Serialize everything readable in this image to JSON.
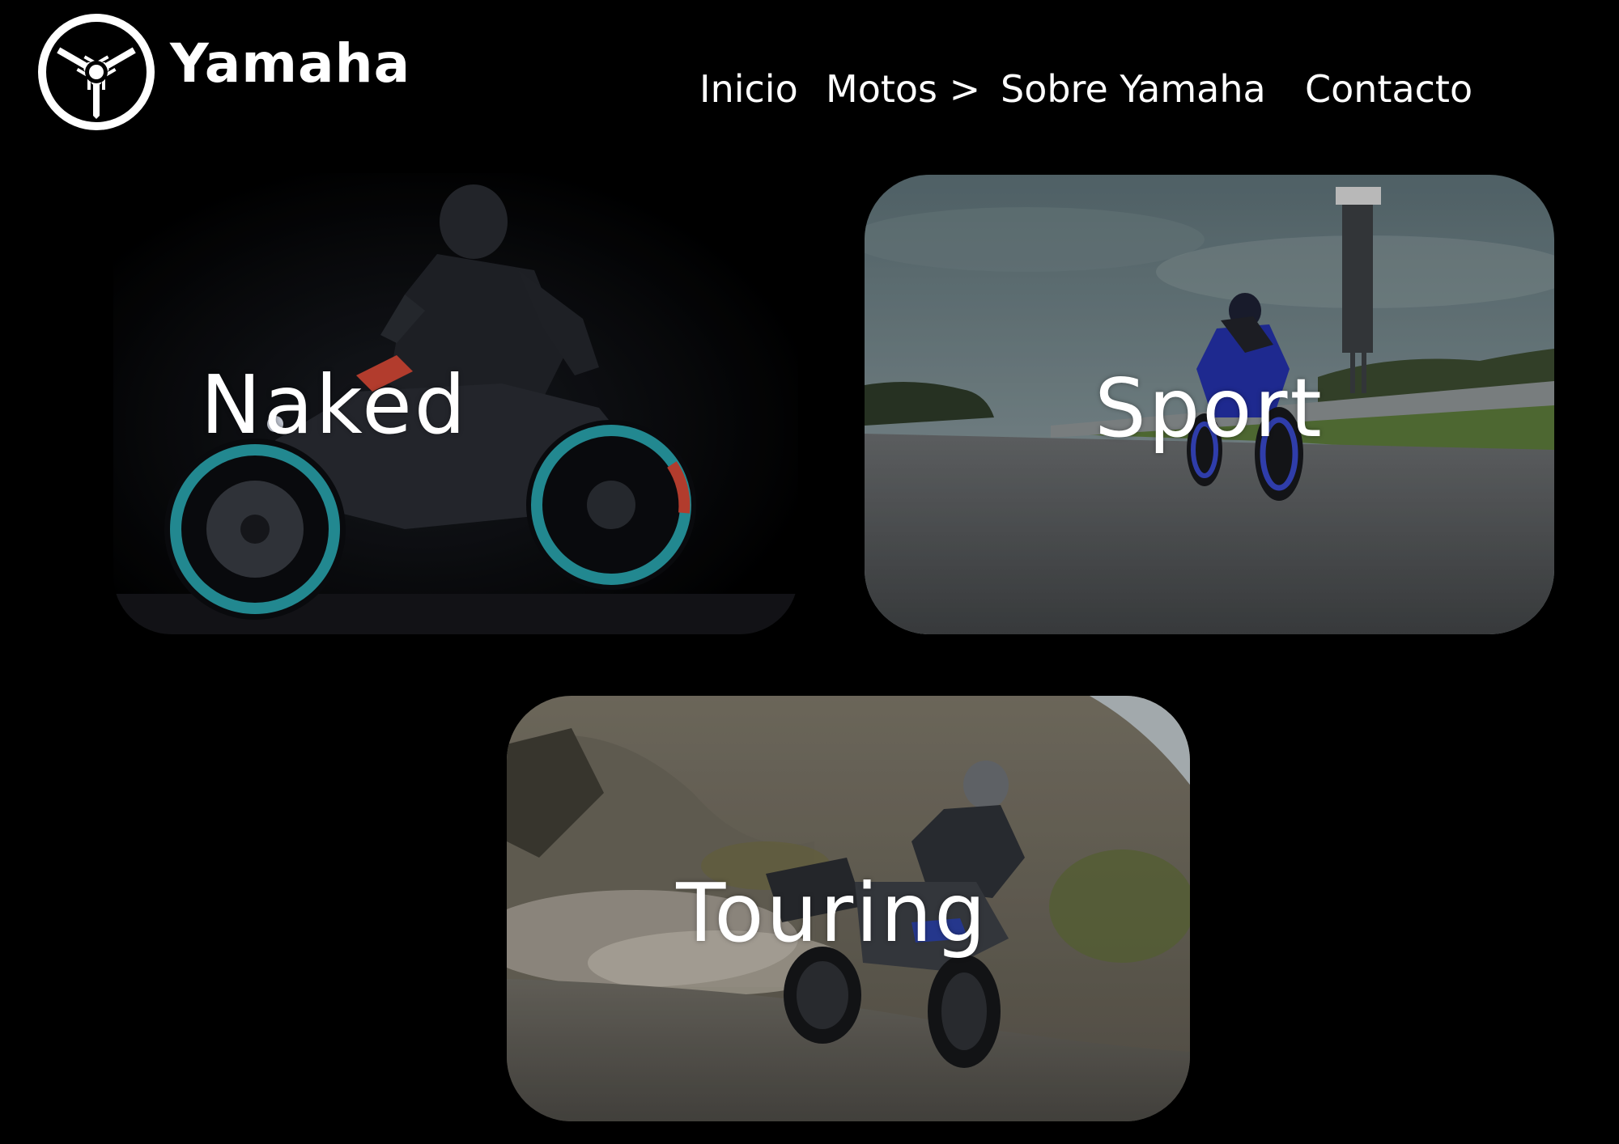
{
  "header": {
    "brand_name": "Yamaha",
    "logo_icon": "yamaha-tuning-forks-icon"
  },
  "nav": {
    "items": [
      {
        "label": "Inicio"
      },
      {
        "label": "Motos >"
      },
      {
        "label": "Sobre Yamaha"
      },
      {
        "label": "Contacto"
      }
    ]
  },
  "categories": [
    {
      "label": "Naked",
      "image": "naked-motorcycle-photo"
    },
    {
      "label": "Sport",
      "image": "sport-motorcycle-photo"
    },
    {
      "label": "Touring",
      "image": "touring-motorcycle-photo"
    }
  ],
  "colors": {
    "background": "#000000",
    "text": "#ffffff",
    "naked_wheel_accent": "#2aa7b0",
    "sport_bike": "#2431a8"
  }
}
